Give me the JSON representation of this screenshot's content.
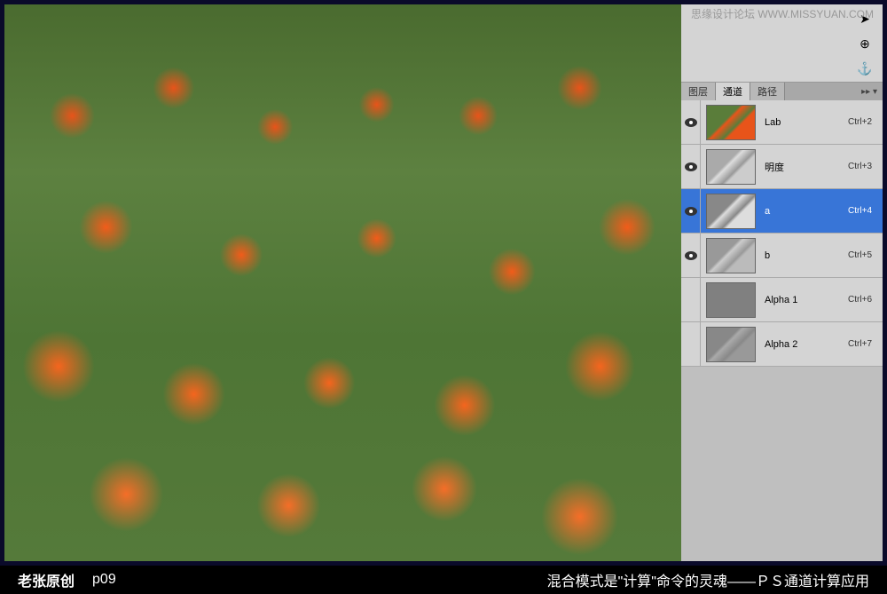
{
  "watermark": "思缘设计论坛 WWW.MISSYUAN.COM",
  "toolIcons": [
    {
      "name": "arrow-icon",
      "glyph": "➤"
    },
    {
      "name": "offset-icon",
      "glyph": "⊕"
    },
    {
      "name": "anchor-icon",
      "glyph": "⚓"
    }
  ],
  "panel": {
    "tabs": [
      {
        "label": "图层",
        "active": false
      },
      {
        "label": "通道",
        "active": true
      },
      {
        "label": "路径",
        "active": false
      }
    ],
    "menuGlyph": "▸▸ ▾"
  },
  "channels": [
    {
      "name": "Lab",
      "shortcut": "Ctrl+2",
      "thumbClass": "thumb-lab",
      "visible": true,
      "selected": false
    },
    {
      "name": "明度",
      "shortcut": "Ctrl+3",
      "thumbClass": "thumb-lightness",
      "visible": true,
      "selected": false
    },
    {
      "name": "a",
      "shortcut": "Ctrl+4",
      "thumbClass": "thumb-a",
      "visible": true,
      "selected": true
    },
    {
      "name": "b",
      "shortcut": "Ctrl+5",
      "thumbClass": "thumb-b",
      "visible": true,
      "selected": false
    },
    {
      "name": "Alpha 1",
      "shortcut": "Ctrl+6",
      "thumbClass": "thumb-alpha1",
      "visible": false,
      "selected": false
    },
    {
      "name": "Alpha 2",
      "shortcut": "Ctrl+7",
      "thumbClass": "thumb-alpha2",
      "visible": false,
      "selected": false
    }
  ],
  "caption": {
    "author": "老张原创",
    "page": "p09",
    "title": "混合模式是\"计算\"命令的灵魂——ＰＳ通道计算应用"
  }
}
